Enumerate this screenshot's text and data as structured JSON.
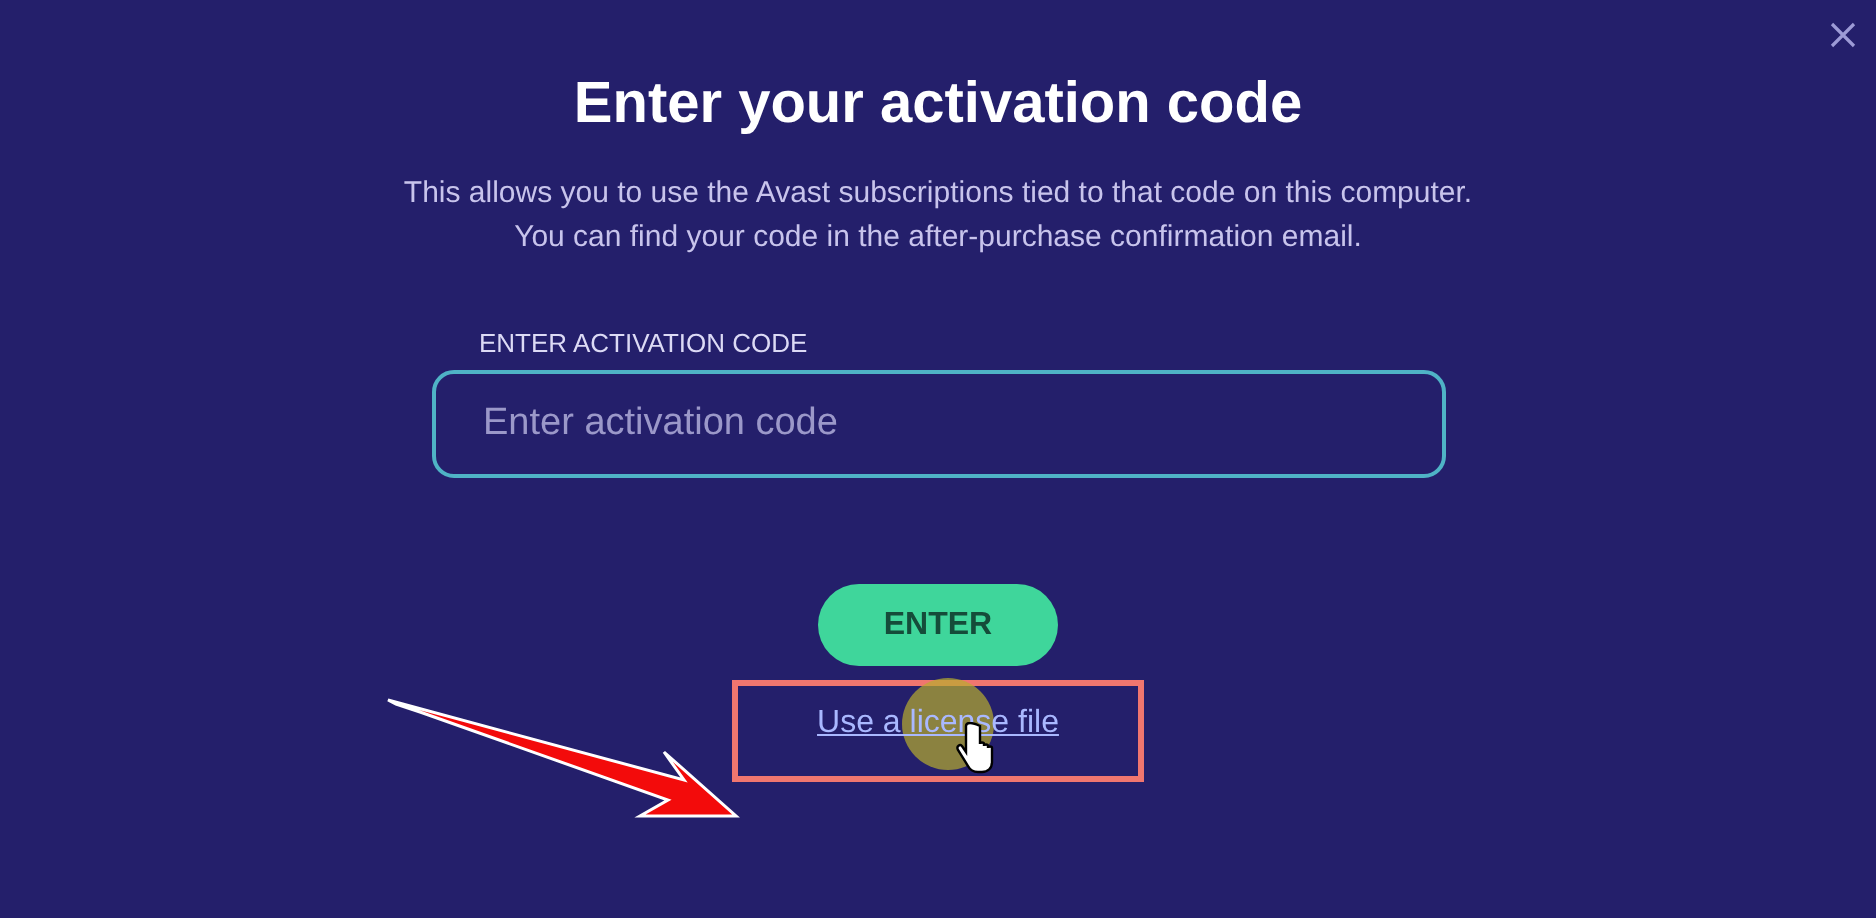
{
  "dialog": {
    "title": "Enter your activation code",
    "description": [
      "This allows you to use the Avast subscriptions tied to that code on this computer.",
      "You can find your code in the after-purchase confirmation email."
    ],
    "field": {
      "label": "ENTER ACTIVATION CODE",
      "placeholder": "Enter activation code"
    },
    "button": "ENTER",
    "link": "Use a license file"
  }
}
